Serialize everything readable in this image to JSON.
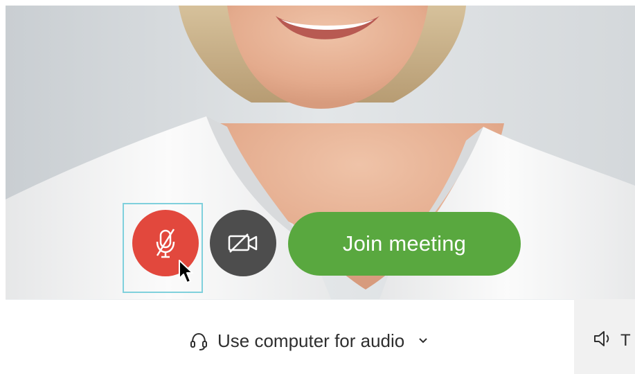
{
  "preview": {
    "subject": "webcam-preview"
  },
  "controls": {
    "mute_state": "muted",
    "video_state": "off",
    "join_label": "Join meeting"
  },
  "audio": {
    "selected_label": "Use computer for audio"
  },
  "speaker": {
    "label": "T"
  },
  "colors": {
    "mute_red": "#e2483d",
    "video_gray": "#4d4d4d",
    "join_green": "#59a83f",
    "focus_ring": "#7fd0dc"
  },
  "icons": {
    "mute": "microphone-muted-icon",
    "video": "video-off-icon",
    "audio": "headset-icon",
    "dropdown": "chevron-down-icon",
    "speaker": "speaker-icon",
    "cursor": "mouse-cursor-icon"
  }
}
